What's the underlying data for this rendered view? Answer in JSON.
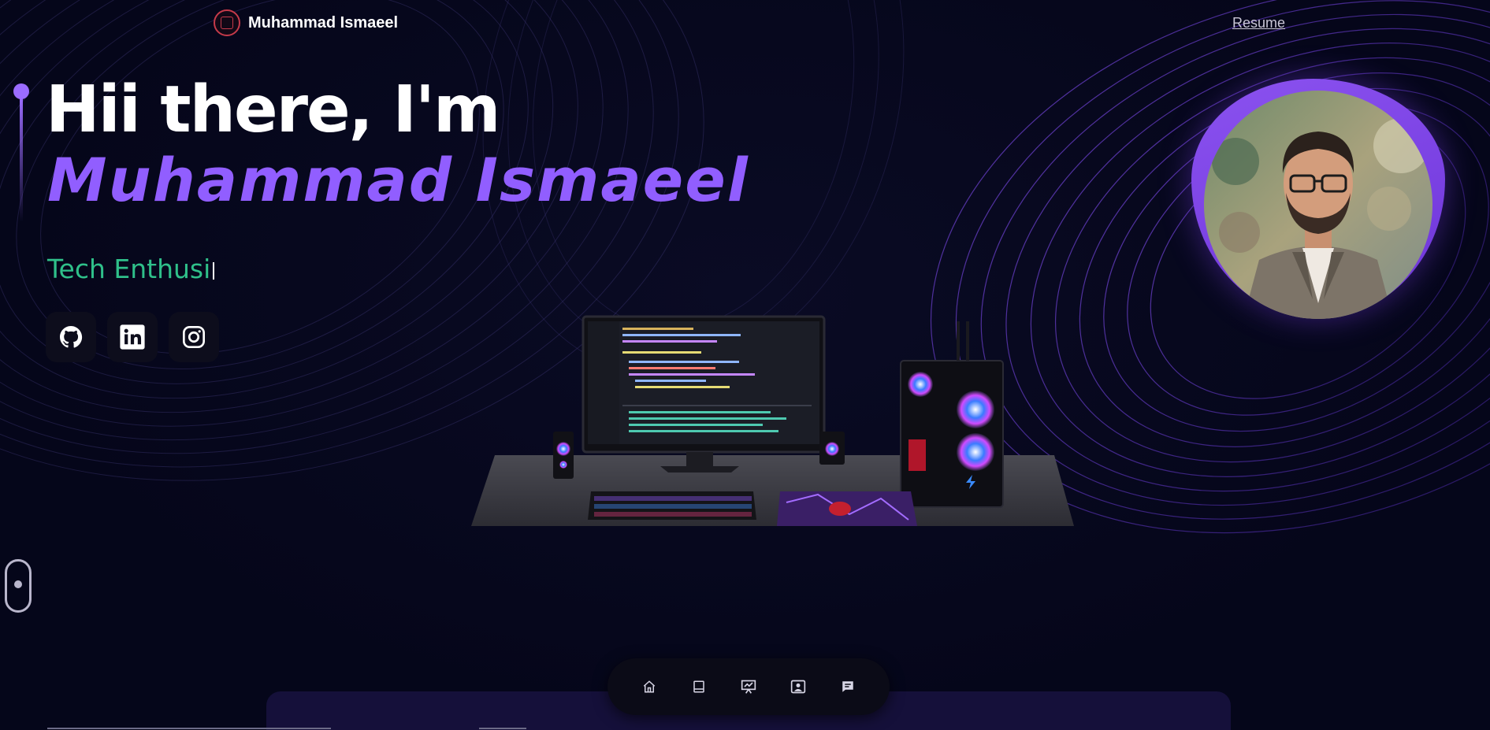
{
  "header": {
    "brand_name": "Muhammad Ismaeel",
    "resume_link": "Resume",
    "logo_icon": "brand-logo-icon"
  },
  "hero": {
    "greeting": "Hii there, I'm",
    "name": "Muhammad Ismaeel",
    "typed_text": "Tech Enthusi"
  },
  "socials": [
    {
      "name": "github",
      "icon": "github-icon"
    },
    {
      "name": "linkedin",
      "icon": "linkedin-icon"
    },
    {
      "name": "instagram",
      "icon": "instagram-icon"
    }
  ],
  "dock": {
    "items": [
      {
        "name": "home",
        "icon": "home-icon"
      },
      {
        "name": "about",
        "icon": "book-icon"
      },
      {
        "name": "projects",
        "icon": "presentation-icon"
      },
      {
        "name": "contact",
        "icon": "contact-card-icon"
      },
      {
        "name": "chat",
        "icon": "chat-icon"
      }
    ]
  },
  "colors": {
    "background": "#06071a",
    "accent_purple": "#915eff",
    "typed_green": "#2fc08a",
    "text_white": "#ffffff"
  }
}
